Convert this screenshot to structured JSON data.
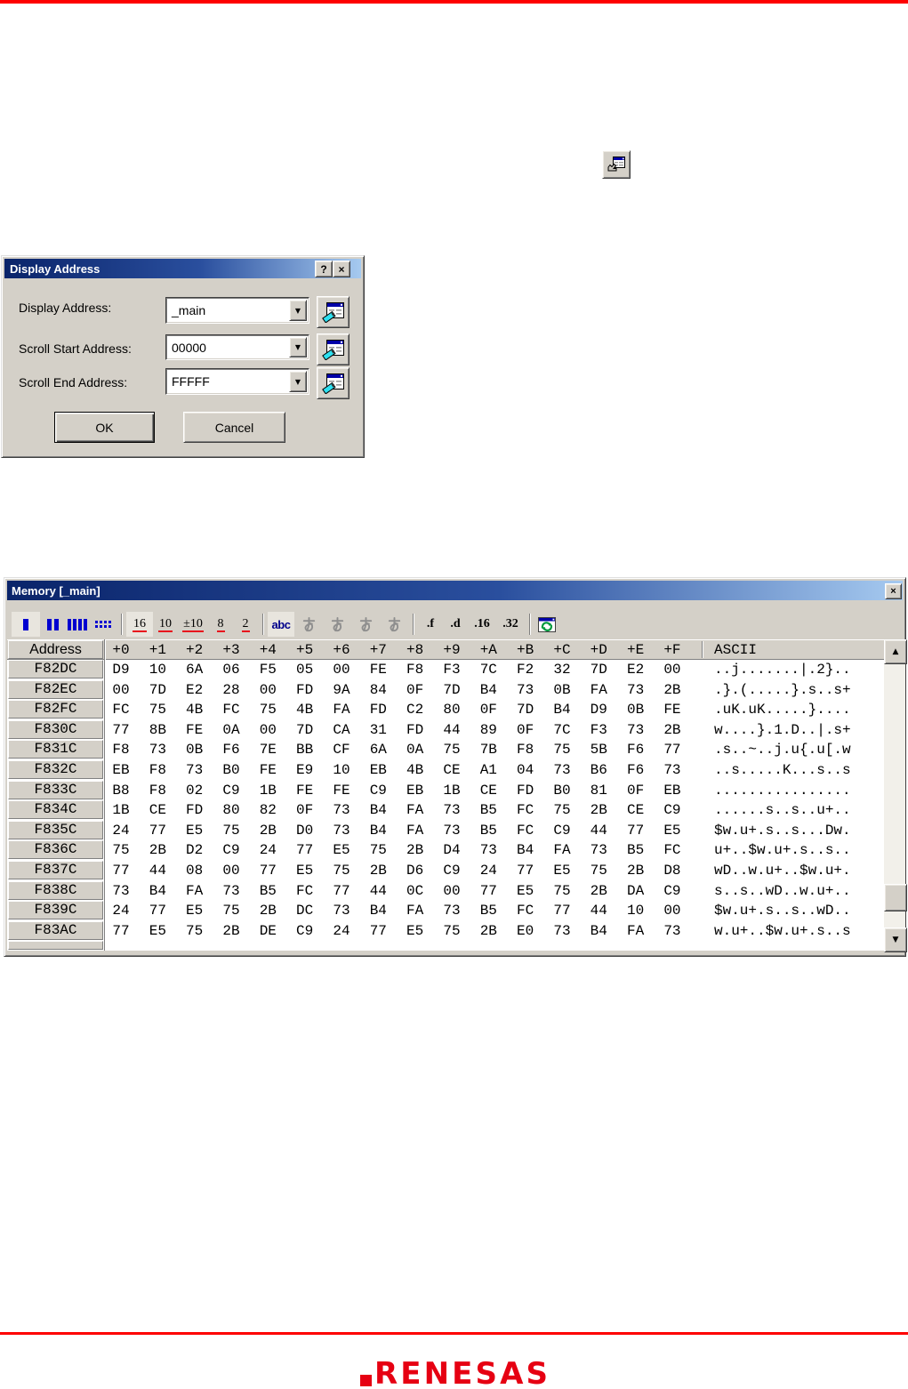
{
  "colors": {
    "rule_red": "#fe0000",
    "brand_red": "#e60012",
    "titlebar_left": "#0a246a",
    "titlebar_right": "#a6caf0",
    "toolbar_blue": "#0000d0",
    "underline_red": "#e8101c",
    "abc_blue": "#00008b"
  },
  "dialog": {
    "title": "Display Address",
    "help_glyph": "?",
    "close_glyph": "×",
    "fields": [
      {
        "label": "Display Address:",
        "value": "_main"
      },
      {
        "label": "Scroll Start Address:",
        "value": "00000"
      },
      {
        "label": "Scroll End Address:",
        "value": "FFFFF"
      }
    ],
    "ok_label": "OK",
    "cancel_label": "Cancel"
  },
  "memory": {
    "title": "Memory [_main]",
    "close_glyph": "×",
    "toolbar": {
      "format_icons": [
        "one-column-icon",
        "two-columns-icon",
        "four-columns-icon",
        "eight-columns-icon"
      ],
      "radix_labels": [
        "16",
        "10",
        "±10",
        "8",
        "2"
      ],
      "radix_pressed": "16",
      "ascii_label": "abc",
      "kana_icons": [
        "kana-a-icon-1",
        "kana-a-icon-2",
        "kana-a-icon-3",
        "kana-a-icon-4"
      ],
      "type_labels": [
        ".f",
        ".d",
        ".16",
        ".32"
      ],
      "refresh_icon": "refresh-icon"
    },
    "table": {
      "address_header": "Address",
      "ascii_header": "ASCII",
      "col_headers": [
        "+0",
        "+1",
        "+2",
        "+3",
        "+4",
        "+5",
        "+6",
        "+7",
        "+8",
        "+9",
        "+A",
        "+B",
        "+C",
        "+D",
        "+E",
        "+F"
      ],
      "rows": [
        {
          "addr": "F82DC",
          "bytes": [
            "D9",
            "10",
            "6A",
            "06",
            "F5",
            "05",
            "00",
            "FE",
            "F8",
            "F3",
            "7C",
            "F2",
            "32",
            "7D",
            "E2",
            "00"
          ],
          "ascii": "..j.......|.2}.."
        },
        {
          "addr": "F82EC",
          "bytes": [
            "00",
            "7D",
            "E2",
            "28",
            "00",
            "FD",
            "9A",
            "84",
            "0F",
            "7D",
            "B4",
            "73",
            "0B",
            "FA",
            "73",
            "2B"
          ],
          "ascii": ".}.(.....}.s..s+"
        },
        {
          "addr": "F82FC",
          "bytes": [
            "FC",
            "75",
            "4B",
            "FC",
            "75",
            "4B",
            "FA",
            "FD",
            "C2",
            "80",
            "0F",
            "7D",
            "B4",
            "D9",
            "0B",
            "FE"
          ],
          "ascii": ".uK.uK.....}...."
        },
        {
          "addr": "F830C",
          "bytes": [
            "77",
            "8B",
            "FE",
            "0A",
            "00",
            "7D",
            "CA",
            "31",
            "FD",
            "44",
            "89",
            "0F",
            "7C",
            "F3",
            "73",
            "2B"
          ],
          "ascii": "w....}.1.D..|.s+"
        },
        {
          "addr": "F831C",
          "bytes": [
            "F8",
            "73",
            "0B",
            "F6",
            "7E",
            "BB",
            "CF",
            "6A",
            "0A",
            "75",
            "7B",
            "F8",
            "75",
            "5B",
            "F6",
            "77"
          ],
          "ascii": ".s..~..j.u{.u[.w"
        },
        {
          "addr": "F832C",
          "bytes": [
            "EB",
            "F8",
            "73",
            "B0",
            "FE",
            "E9",
            "10",
            "EB",
            "4B",
            "CE",
            "A1",
            "04",
            "73",
            "B6",
            "F6",
            "73"
          ],
          "ascii": "..s.....K...s..s"
        },
        {
          "addr": "F833C",
          "bytes": [
            "B8",
            "F8",
            "02",
            "C9",
            "1B",
            "FE",
            "FE",
            "C9",
            "EB",
            "1B",
            "CE",
            "FD",
            "B0",
            "81",
            "0F",
            "EB"
          ],
          "ascii": "................"
        },
        {
          "addr": "F834C",
          "bytes": [
            "1B",
            "CE",
            "FD",
            "80",
            "82",
            "0F",
            "73",
            "B4",
            "FA",
            "73",
            "B5",
            "FC",
            "75",
            "2B",
            "CE",
            "C9"
          ],
          "ascii": "......s..s..u+.."
        },
        {
          "addr": "F835C",
          "bytes": [
            "24",
            "77",
            "E5",
            "75",
            "2B",
            "D0",
            "73",
            "B4",
            "FA",
            "73",
            "B5",
            "FC",
            "C9",
            "44",
            "77",
            "E5"
          ],
          "ascii": "$w.u+.s..s...Dw."
        },
        {
          "addr": "F836C",
          "bytes": [
            "75",
            "2B",
            "D2",
            "C9",
            "24",
            "77",
            "E5",
            "75",
            "2B",
            "D4",
            "73",
            "B4",
            "FA",
            "73",
            "B5",
            "FC"
          ],
          "ascii": "u+..$w.u+.s..s.."
        },
        {
          "addr": "F837C",
          "bytes": [
            "77",
            "44",
            "08",
            "00",
            "77",
            "E5",
            "75",
            "2B",
            "D6",
            "C9",
            "24",
            "77",
            "E5",
            "75",
            "2B",
            "D8"
          ],
          "ascii": "wD..w.u+..$w.u+."
        },
        {
          "addr": "F838C",
          "bytes": [
            "73",
            "B4",
            "FA",
            "73",
            "B5",
            "FC",
            "77",
            "44",
            "0C",
            "00",
            "77",
            "E5",
            "75",
            "2B",
            "DA",
            "C9"
          ],
          "ascii": "s..s..wD..w.u+.."
        },
        {
          "addr": "F839C",
          "bytes": [
            "24",
            "77",
            "E5",
            "75",
            "2B",
            "DC",
            "73",
            "B4",
            "FA",
            "73",
            "B5",
            "FC",
            "77",
            "44",
            "10",
            "00"
          ],
          "ascii": "$w.u+.s..s..wD.."
        },
        {
          "addr": "F83AC",
          "bytes": [
            "77",
            "E5",
            "75",
            "2B",
            "DE",
            "C9",
            "24",
            "77",
            "E5",
            "75",
            "2B",
            "E0",
            "73",
            "B4",
            "FA",
            "73"
          ],
          "ascii": "w.u+..$w.u+.s..s"
        }
      ]
    },
    "scrollbar": {
      "up_glyph": "▲",
      "down_glyph": "▼"
    }
  },
  "footer": {
    "brand": "RENESAS"
  }
}
